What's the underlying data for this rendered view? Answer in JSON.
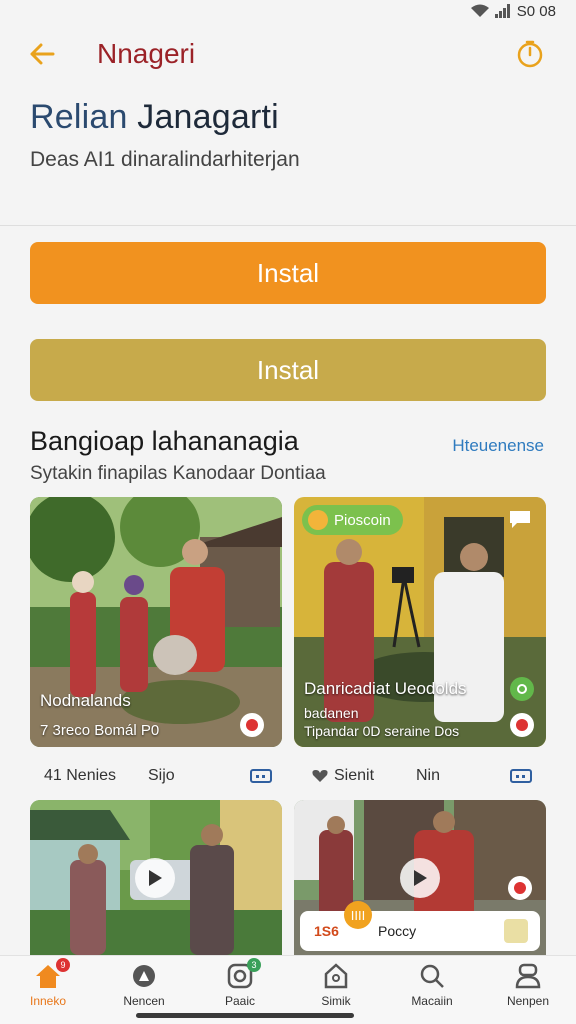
{
  "status_bar": {
    "time": "S0 08"
  },
  "app_bar": {
    "title": "Nnageri"
  },
  "header": {
    "title_part1": "Relian",
    "title_part2": "Janagarti",
    "subtitle": "Deas AI1 dinaralindarhiterjan"
  },
  "buttons": {
    "primary_label": "Instal",
    "secondary_label": "Instal"
  },
  "section": {
    "title": "Bangioap lahananagia",
    "link": "Hteuenense",
    "subtitle": "Sytakin finapilas Kanodaar Dontiaa"
  },
  "cards": [
    {
      "title": "Nodnalands",
      "meta": "7 3reco Bomál  P0"
    },
    {
      "badge": "Pioscoin",
      "title": "Danricadiat Ueodolds",
      "meta1": "badanen",
      "meta2": "Tipandar  0D  seraine Dos"
    },
    {},
    {
      "chip_num": "1S6",
      "chip_coin": "IIII",
      "chip_label": "Poccy"
    }
  ],
  "card_meta": [
    {
      "a": "41 Nenies",
      "b": "Sijo"
    },
    {
      "a": "Sienit",
      "b": "Nin"
    }
  ],
  "colors": {
    "primary": "#f1921f",
    "secondary": "#c7aa4b",
    "title_red": "#9b2227",
    "link_blue": "#2f7bbf"
  },
  "bottom_nav": [
    {
      "label": "Inneko",
      "icon": "home-icon",
      "badge": "9"
    },
    {
      "label": "Nencen",
      "icon": "explore-icon"
    },
    {
      "label": "Paaic",
      "icon": "camera-icon",
      "badge": "3"
    },
    {
      "label": "Simik",
      "icon": "shop-icon"
    },
    {
      "label": "Macaiin",
      "icon": "search-icon"
    },
    {
      "label": "Nenpen",
      "icon": "profile-icon"
    }
  ]
}
